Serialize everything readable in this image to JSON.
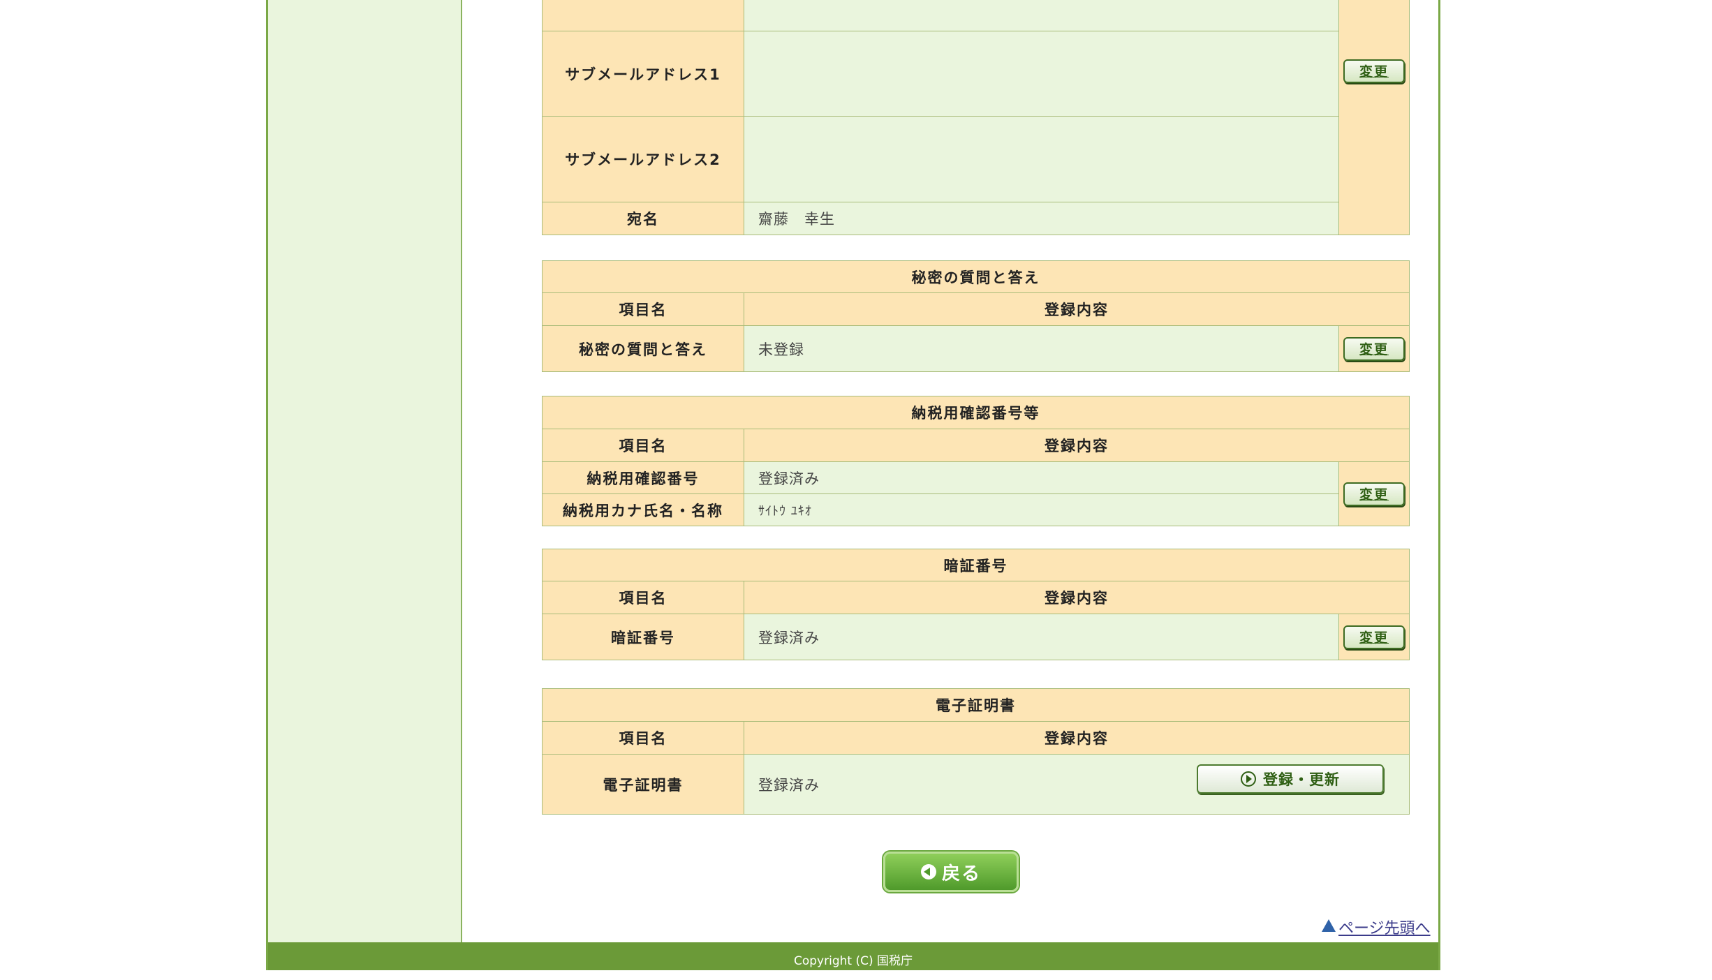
{
  "contact": {
    "rows": [
      {
        "label": "サブメールアドレス1",
        "value": ""
      },
      {
        "label": "サブメールアドレス2",
        "value": ""
      },
      {
        "label": "宛名",
        "value": "齋藤　幸生"
      }
    ],
    "change_label": "変更"
  },
  "secret": {
    "title": "秘密の質問と答え",
    "col_item": "項目名",
    "col_content": "登録内容",
    "rows": [
      {
        "label": "秘密の質問と答え",
        "value": "未登録"
      }
    ],
    "change_label": "変更"
  },
  "tax": {
    "title": "納税用確認番号等",
    "col_item": "項目名",
    "col_content": "登録内容",
    "rows": [
      {
        "label": "納税用確認番号",
        "value": "登録済み"
      },
      {
        "label": "納税用カナ氏名・名称",
        "value": "ｻｲﾄｳ ﾕｷｵ"
      }
    ],
    "change_label": "変更"
  },
  "pin": {
    "title": "暗証番号",
    "col_item": "項目名",
    "col_content": "登録内容",
    "rows": [
      {
        "label": "暗証番号",
        "value": "登録済み"
      }
    ],
    "change_label": "変更"
  },
  "cert": {
    "title": "電子証明書",
    "col_item": "項目名",
    "col_content": "登録内容",
    "rows": [
      {
        "label": "電子証明書",
        "value": "登録済み"
      }
    ],
    "register_label": "登録・更新"
  },
  "back_label": "戻る",
  "page_top_label": "ページ先頭へ",
  "footer": {
    "copyright": "Copyright (C) 国税庁"
  },
  "colors": {
    "accent": "#6b9a38",
    "header_bg": "#fde5b5",
    "value_bg": "#eaf5dd"
  }
}
